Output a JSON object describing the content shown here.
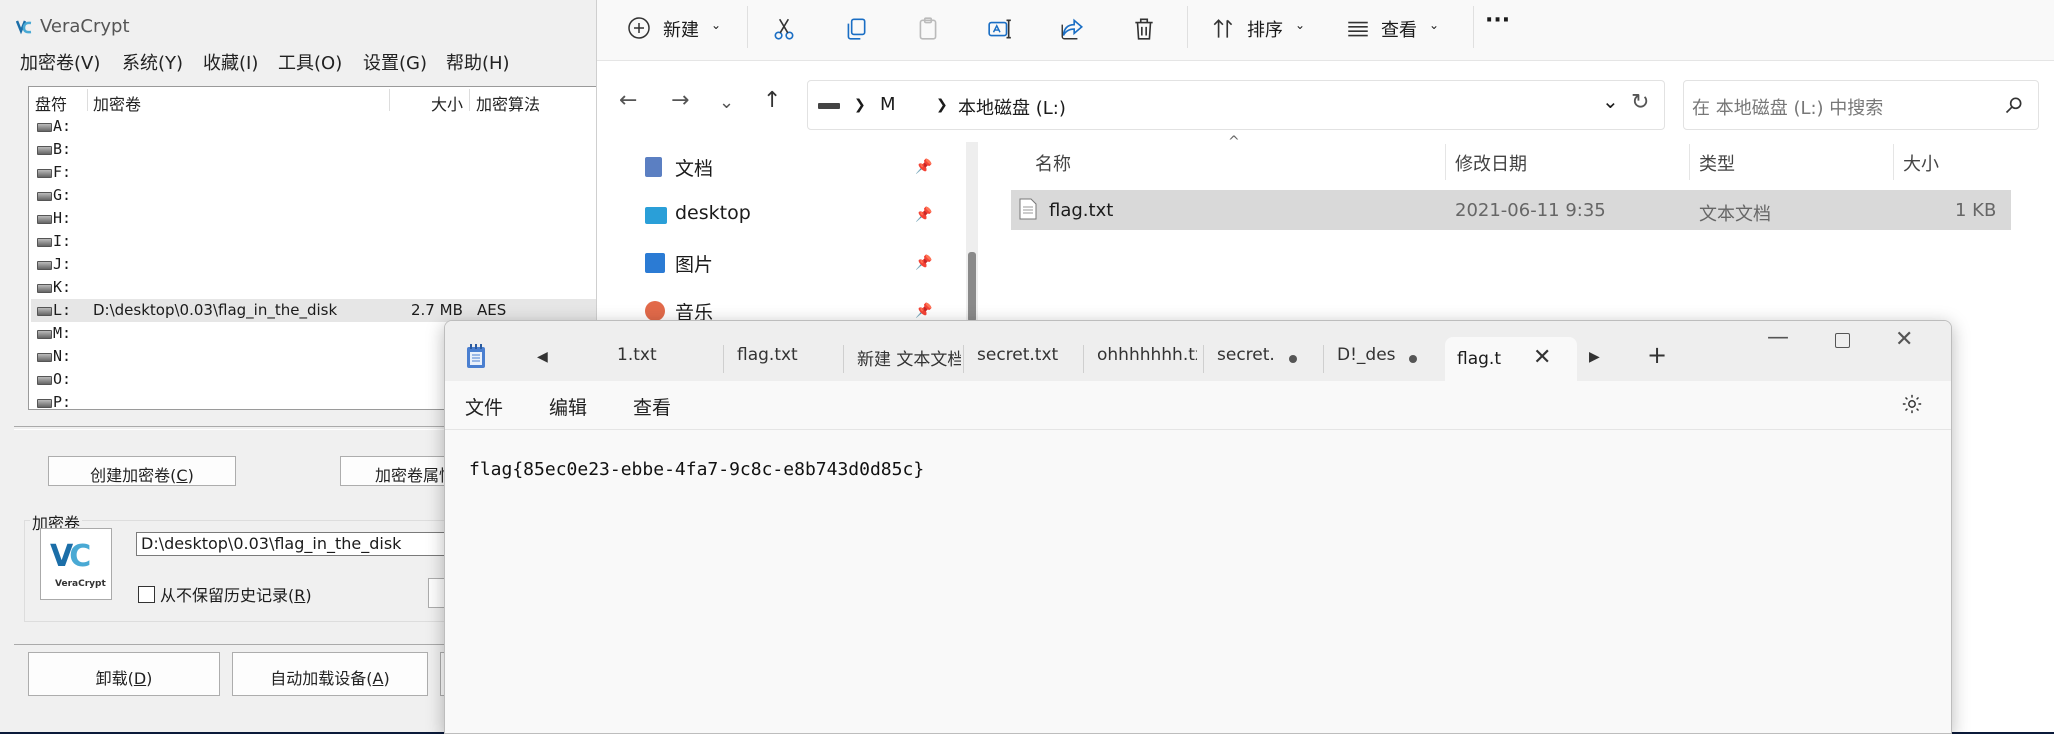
{
  "veracrypt": {
    "title": "VeraCrypt",
    "menu": [
      "加密卷(V)",
      "系统(Y)",
      "收藏(I)",
      "工具(O)",
      "设置(G)",
      "帮助(H)"
    ],
    "columns": {
      "drive": "盘符",
      "volume": "加密卷",
      "size": "大小",
      "algorithm": "加密算法"
    },
    "drives": [
      {
        "letter": "A:",
        "volume": "",
        "size": "",
        "alg": ""
      },
      {
        "letter": "B:",
        "volume": "",
        "size": "",
        "alg": ""
      },
      {
        "letter": "F:",
        "volume": "",
        "size": "",
        "alg": ""
      },
      {
        "letter": "G:",
        "volume": "",
        "size": "",
        "alg": ""
      },
      {
        "letter": "H:",
        "volume": "",
        "size": "",
        "alg": ""
      },
      {
        "letter": "I:",
        "volume": "",
        "size": "",
        "alg": ""
      },
      {
        "letter": "J:",
        "volume": "",
        "size": "",
        "alg": ""
      },
      {
        "letter": "K:",
        "volume": "",
        "size": "",
        "alg": ""
      },
      {
        "letter": "L:",
        "volume": "D:\\desktop\\0.03\\flag_in_the_disk",
        "size": "2.7 MB",
        "alg": "AES"
      },
      {
        "letter": "M:",
        "volume": "",
        "size": "",
        "alg": ""
      },
      {
        "letter": "N:",
        "volume": "",
        "size": "",
        "alg": ""
      },
      {
        "letter": "O:",
        "volume": "",
        "size": "",
        "alg": ""
      },
      {
        "letter": "P:",
        "volume": "",
        "size": "",
        "alg": ""
      }
    ],
    "create_volume": {
      "text": "创建加密卷(",
      "key": "C",
      "end": ")"
    },
    "volume_props": {
      "text": "加密卷属性"
    },
    "volume_group_label": "加密卷",
    "logo_name": "VeraCrypt",
    "volume_path": "D:\\desktop\\0.03\\flag_in_the_disk",
    "no_history": {
      "text": "从不保留历史记录(",
      "key": "R",
      "end": ")"
    },
    "dismount": {
      "text": "卸载(",
      "key": "D",
      "end": ")"
    },
    "auto_mount": {
      "text": "自动加载设备(",
      "key": "A",
      "end": ")"
    }
  },
  "explorer": {
    "toolbar": {
      "new": "新建",
      "sort": "排序",
      "view": "查看",
      "more": "···"
    },
    "breadcrumb": [
      "M",
      "本地磁盘 (L:)"
    ],
    "search_placeholder": "在 本地磁盘 (L:) 中搜索",
    "nav_items": [
      {
        "label": "文档",
        "color": "#5b7fc2"
      },
      {
        "label": "desktop",
        "color": "#2a9fd8"
      },
      {
        "label": "图片",
        "color": "#2b7bd4"
      },
      {
        "label": "音乐",
        "color": "#e26a4a"
      }
    ],
    "columns": {
      "name": "名称",
      "modified": "修改日期",
      "type": "类型",
      "size": "大小"
    },
    "files": [
      {
        "name": "flag.txt",
        "modified": "2021-06-11 9:35",
        "type": "文本文档",
        "size": "1 KB"
      }
    ]
  },
  "notepad": {
    "tabs": [
      "1.txt",
      "flag.txt",
      "新建 文本文档",
      "secret.txt",
      "ohhhhhhh.txt",
      "secret.",
      "D!_des"
    ],
    "active_tab": "flag.t",
    "menu": [
      "文件",
      "编辑",
      "查看"
    ],
    "content": "flag{85ec0e23-ebbe-4fa7-9c8c-e8b743d0d85c}"
  }
}
